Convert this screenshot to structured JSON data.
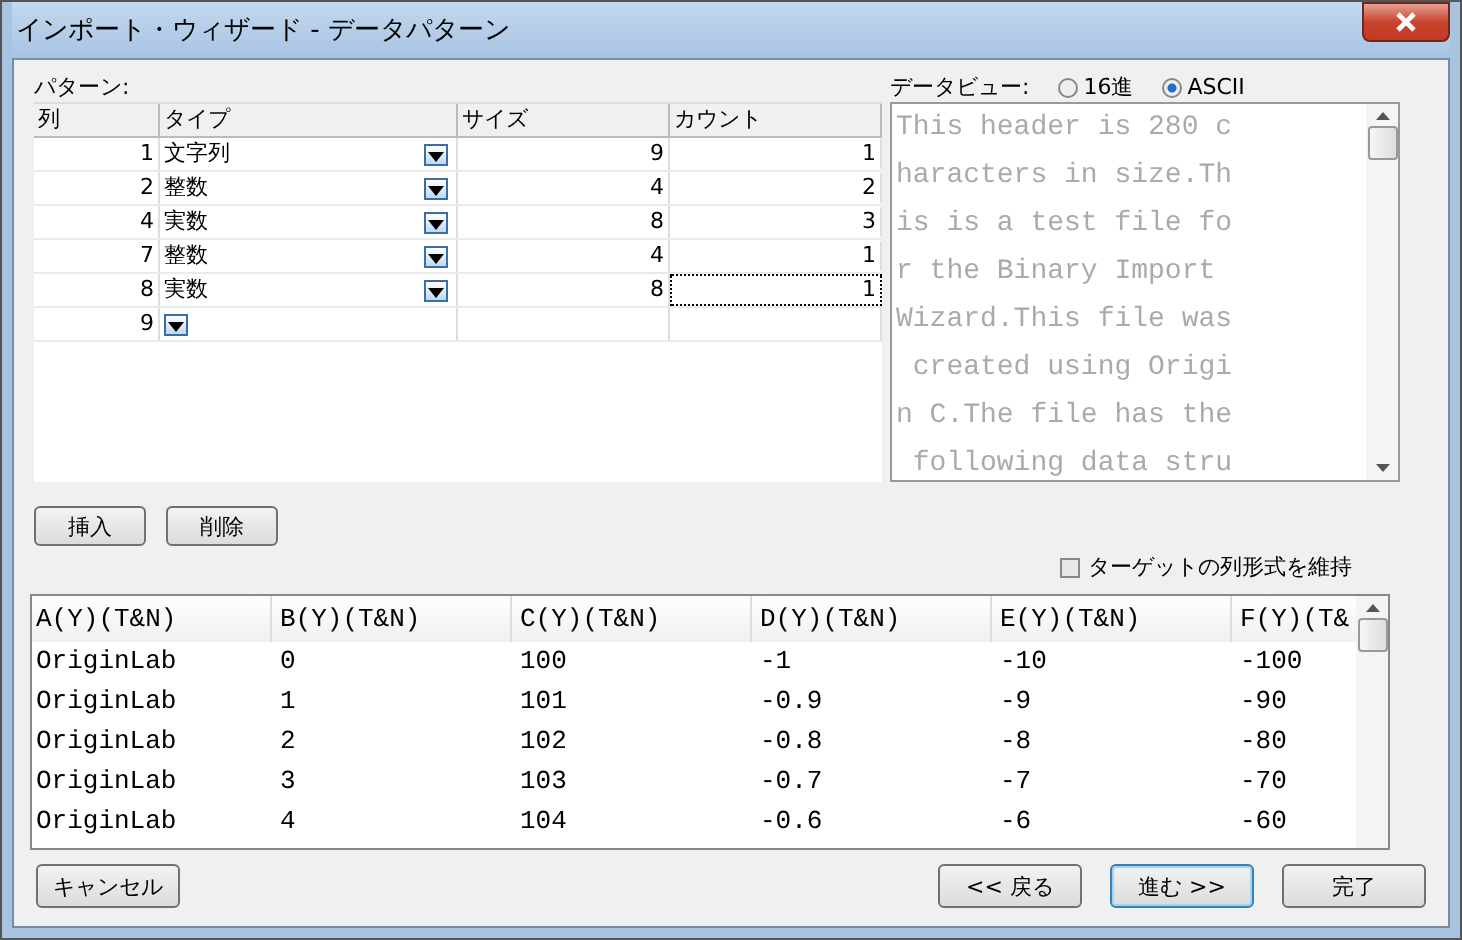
{
  "window": {
    "title": "インポート・ウィザード - データパターン"
  },
  "pattern": {
    "label": "パターン:",
    "columns": [
      "列",
      "タイプ",
      "サイズ",
      "カウント"
    ],
    "rows": [
      {
        "col": "1",
        "type": "文字列",
        "size": "9",
        "count": "1",
        "focused": false
      },
      {
        "col": "2",
        "type": "整数",
        "size": "4",
        "count": "2",
        "focused": false
      },
      {
        "col": "4",
        "type": "実数",
        "size": "8",
        "count": "3",
        "focused": false
      },
      {
        "col": "7",
        "type": "整数",
        "size": "4",
        "count": "1",
        "focused": false
      },
      {
        "col": "8",
        "type": "実数",
        "size": "8",
        "count": "1",
        "focused": true
      },
      {
        "col": "9"
      }
    ]
  },
  "data_view": {
    "label": "データビュー:",
    "options": [
      {
        "label": "16進",
        "selected": false
      },
      {
        "label": "ASCII",
        "selected": true
      }
    ],
    "lines": [
      "This header is 280 c",
      "haracters in size.Th",
      "is is a test file fo",
      "r the Binary Import",
      "Wizard.This file was",
      " created using Origi",
      "n C.The file has the",
      " following data stru"
    ]
  },
  "buttons": [
    {
      "label": "挿入"
    },
    {
      "label": "削除"
    }
  ],
  "keep_format": {
    "label": "ターゲットの列形式を維持",
    "checked": false
  },
  "preview": {
    "columns": [
      "A(Y)(T&N)",
      "B(Y)(T&N)",
      "C(Y)(T&N)",
      "D(Y)(T&N)",
      "E(Y)(T&N)",
      "F(Y)(T&"
    ],
    "rows": [
      [
        "OriginLab",
        "0",
        "100",
        "-1",
        "-10",
        "-100"
      ],
      [
        "OriginLab",
        "1",
        "101",
        "-0.9",
        "-9",
        "-90"
      ],
      [
        "OriginLab",
        "2",
        "102",
        "-0.8",
        "-8",
        "-80"
      ],
      [
        "OriginLab",
        "3",
        "103",
        "-0.7",
        "-7",
        "-70"
      ],
      [
        "OriginLab",
        "4",
        "104",
        "-0.6",
        "-6",
        "-60"
      ]
    ]
  },
  "footer": [
    {
      "label": "キャンセル",
      "default": false
    },
    {
      "label": "<< 戻る",
      "default": false
    },
    {
      "label": "進む >>",
      "default": true
    },
    {
      "label": "完了",
      "default": false
    }
  ]
}
